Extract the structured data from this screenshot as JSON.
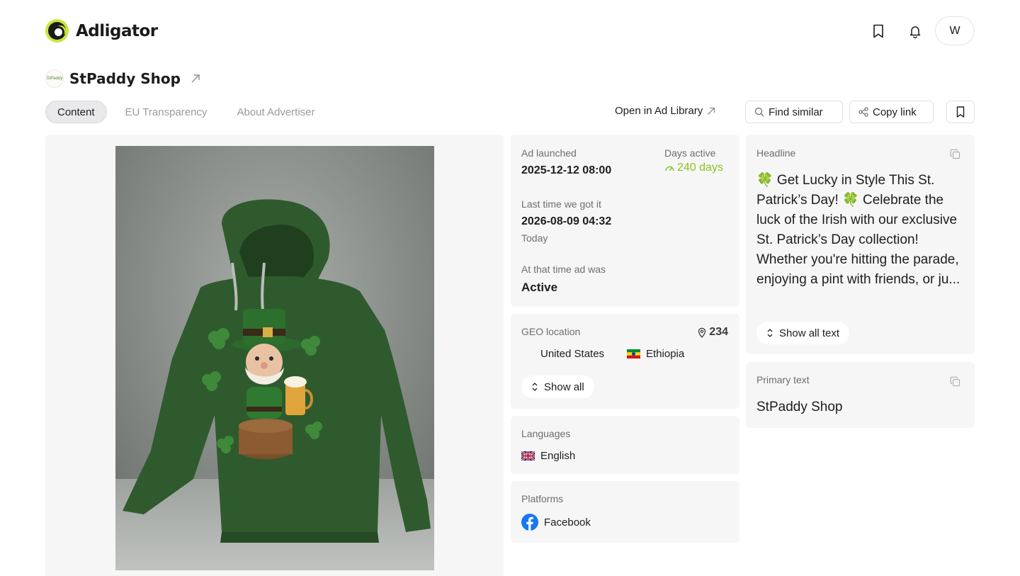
{
  "app": {
    "name": "Adligator",
    "avatar_initial": "W"
  },
  "header_icons": [
    "bookmark-icon",
    "bell-icon"
  ],
  "advertiser": {
    "name": "StPaddy Shop",
    "logo_text": "StPaddy"
  },
  "tabs": [
    {
      "label": "Content",
      "active": true
    },
    {
      "label": "EU Transparency",
      "active": false
    },
    {
      "label": "About Advertiser",
      "active": false
    }
  ],
  "actions": {
    "open_ad_library": "Open in Ad Library",
    "find_similar": "Find similar",
    "copy_link": "Copy link"
  },
  "stats": {
    "ad_launched_label": "Ad launched",
    "ad_launched_value": "2025-12-12 08:00",
    "days_active_label": "Days active",
    "days_active_value": "240 days",
    "last_seen_label": "Last time we got it",
    "last_seen_value": "2026-08-09 04:32",
    "last_seen_relative": "Today",
    "status_label": "At that time ad was",
    "status_value": "Active"
  },
  "geo": {
    "label": "GEO location",
    "count": "234",
    "countries": [
      "United States",
      "Ethiopia"
    ],
    "show_all": "Show all"
  },
  "languages": {
    "label": "Languages",
    "items": [
      "English"
    ]
  },
  "platforms": {
    "label": "Platforms",
    "items": [
      "Facebook"
    ]
  },
  "headline": {
    "label": "Headline",
    "text": "🍀 Get Lucky in Style This St. Patrick’s Day! 🍀 Celebrate the luck of the Irish with our exclusive St. Patrick’s Day collection! Whether you're hitting the parade, enjoying a pint with friends, or ju...",
    "show_all": "Show all text"
  },
  "primary_text": {
    "label": "Primary text",
    "text": "StPaddy Shop"
  },
  "colors": {
    "accent_green": "#8dc21f",
    "brand_lime": "#c8e63c",
    "facebook_blue": "#1877f2"
  }
}
